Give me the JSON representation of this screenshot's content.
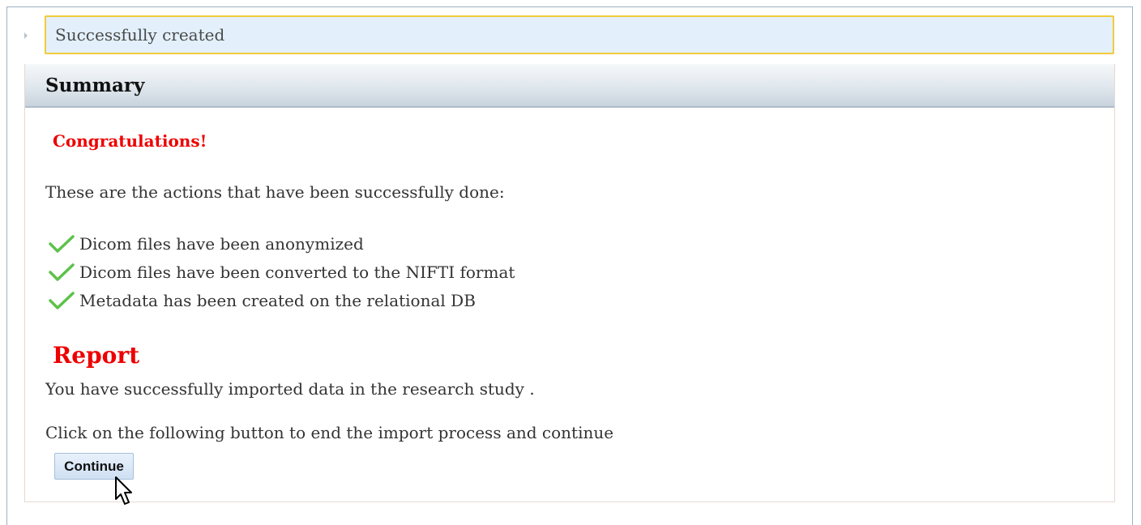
{
  "message": {
    "text": "Successfully created"
  },
  "panel": {
    "title": "Summary",
    "congrats": "Congratulations!",
    "intro": "These are the actions that have been successfully done:",
    "actions": [
      {
        "icon": "check-icon",
        "text": "Dicom files have been anonymized"
      },
      {
        "icon": "check-icon",
        "text": "Dicom files have been converted to the NIFTI format"
      },
      {
        "icon": "check-icon",
        "text": "Metadata has been created on the relational DB"
      }
    ],
    "report": {
      "title": "Report",
      "text": "You have successfully imported data in the research study .",
      "instruction": "Click on the following button to end the import process and continue",
      "button_label": "Continue"
    }
  },
  "colors": {
    "accent_red": "#ee0000",
    "message_bg": "#e3f0fb",
    "message_border": "#f2cb3b",
    "check_green": "#5cc24a"
  }
}
